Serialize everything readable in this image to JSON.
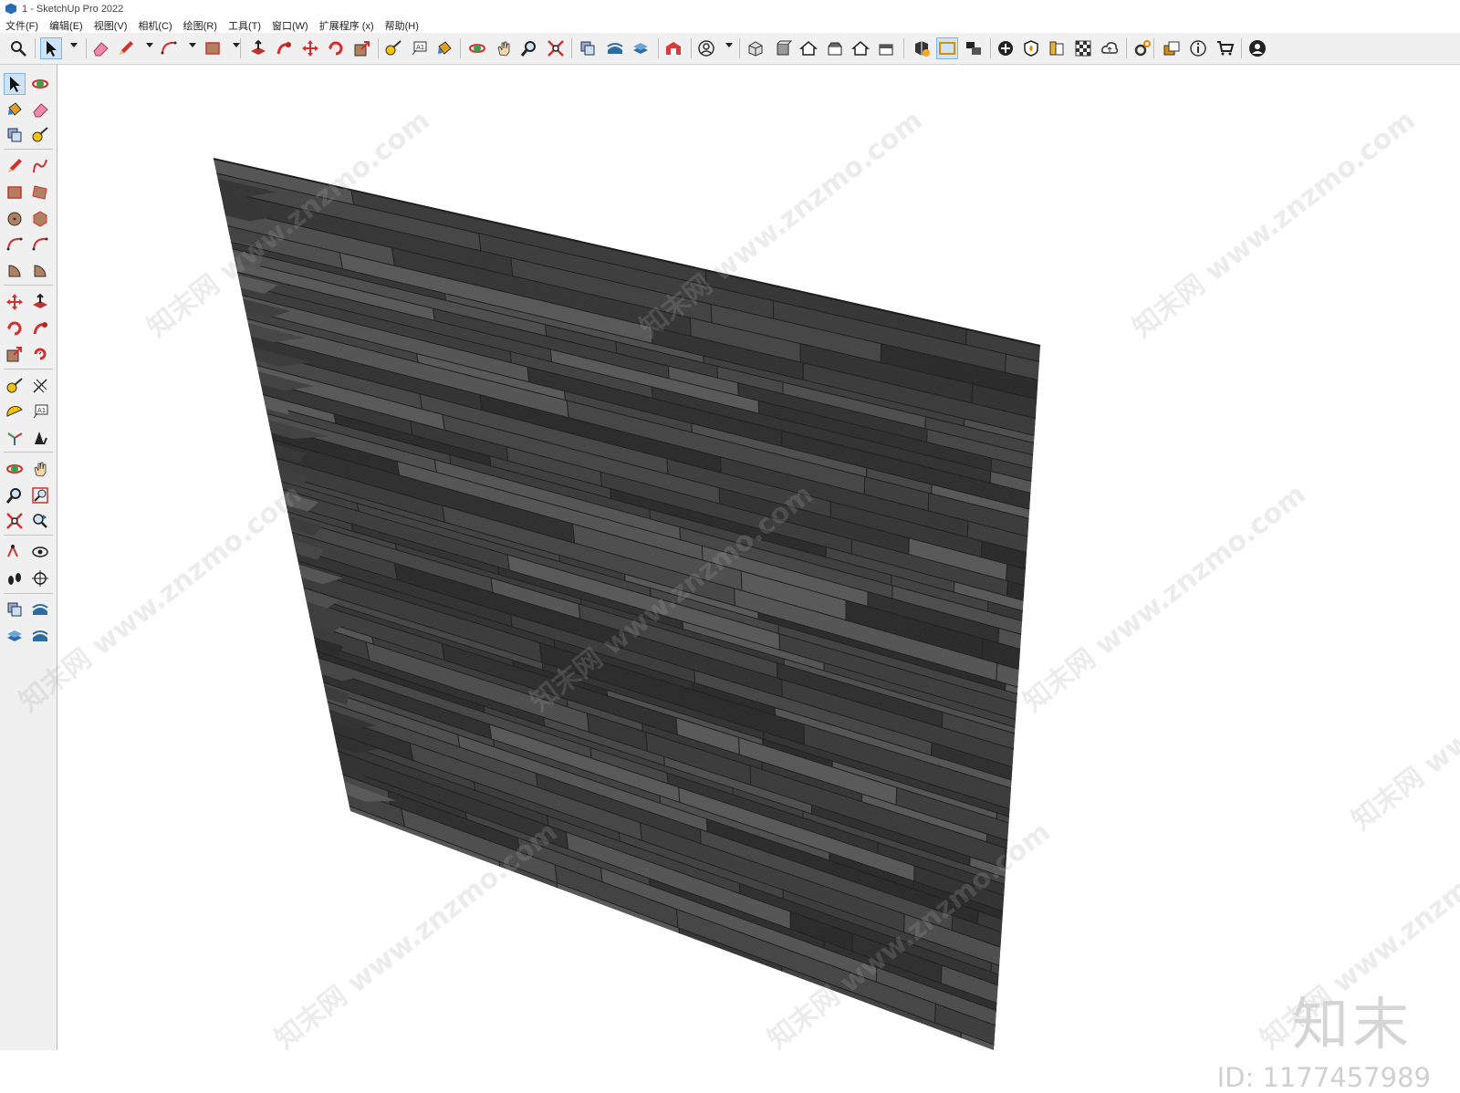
{
  "window": {
    "title": "1 - SketchUp Pro 2022"
  },
  "menu": [
    "文件(F)",
    "编辑(E)",
    "视图(V)",
    "相机(C)",
    "绘图(R)",
    "工具(T)",
    "窗口(W)",
    "扩展程序 (x)",
    "帮助(H)"
  ],
  "toolbar_icons": [
    "search-icon",
    "select-icon",
    "eraser-icon",
    "pencil-icon",
    "arc-icon",
    "rectangle-icon",
    "push-pull-icon",
    "follow-me-icon",
    "move-icon",
    "rotate-icon",
    "scale-icon",
    "tape-measure-icon",
    "text-icon",
    "paint-bucket-icon",
    "orbit-icon",
    "pan-icon",
    "zoom-icon",
    "zoom-extents-icon",
    "solid-tools-icon",
    "sandbox-icon",
    "layers-icon",
    "warehouse-icon",
    "account-icon",
    "iso-view-icon",
    "front-view-icon",
    "home-view-icon",
    "top-view-icon",
    "back-view-icon",
    "side-view-icon",
    "component-icon",
    "outliner-icon",
    "scenes-icon",
    "add-location-icon",
    "shadow-icon",
    "materials-icon",
    "style-icon",
    "cloud-icon",
    "extension-icon",
    "tags-icon",
    "info-icon",
    "cart-icon",
    "user-icon"
  ],
  "watermark": {
    "url": "www.znzmo.com",
    "cn": "知末网"
  },
  "brand": {
    "logo": "知末",
    "id": "ID: 1177457989"
  }
}
